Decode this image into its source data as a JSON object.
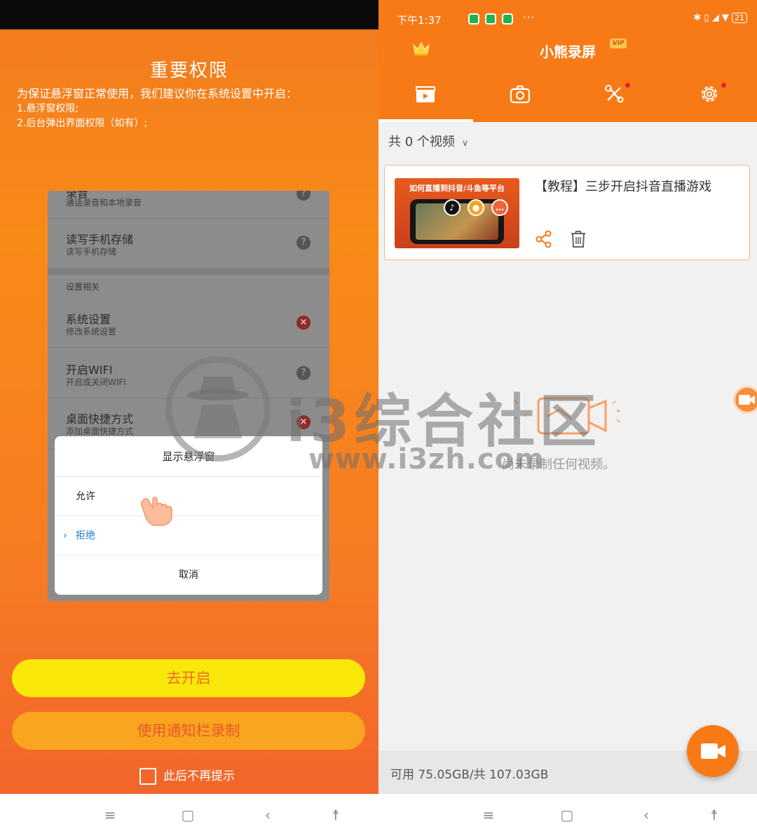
{
  "left": {
    "title": "重要权限",
    "description": "为保证悬浮窗正常使用，我们建议你在系统设置中开启：",
    "items": [
      "1.悬浮窗权限;",
      "2.后台弹出界面权限（如有）;"
    ],
    "permissions": [
      {
        "title": "录音",
        "subtitle": "通话录音和本地录音",
        "status": "help"
      },
      {
        "title": "读写手机存储",
        "subtitle": "读写手机存储",
        "status": "help"
      },
      {
        "title": "系统设置",
        "subtitle": "修改系统设置",
        "status": "deny"
      },
      {
        "title": "开启WIFI",
        "subtitle": "开启或关闭WIFI",
        "status": "help"
      },
      {
        "title": "桌面快捷方式",
        "subtitle": "添加桌面快捷方式",
        "status": "deny"
      }
    ],
    "section_label": "设置相关",
    "dialog": {
      "title": "显示悬浮窗",
      "options": [
        "允许",
        "拒绝"
      ],
      "selected": "拒绝",
      "cancel": "取消"
    },
    "primary_button": "去开启",
    "secondary_button": "使用通知栏录制",
    "checkbox_label": "此后不再提示"
  },
  "right": {
    "status_bar": {
      "time": "下午1:37",
      "more": "···",
      "battery": "21"
    },
    "app_title": "小熊录屏",
    "vip_badge": "VIP",
    "tabs": [
      {
        "icon": "video-tab-icon",
        "active": true
      },
      {
        "icon": "camera-tab-icon",
        "active": false
      },
      {
        "icon": "tools-tab-icon",
        "active": false,
        "dot": true
      },
      {
        "icon": "settings-tab-icon",
        "active": false,
        "dot": true
      }
    ],
    "filter_label": "共 0 个视频",
    "video": {
      "thumbnail_caption": "如何直播到抖音/斗鱼等平台",
      "title": "【教程】三步开启抖音直播游戏"
    },
    "empty_text": "尚未录制任何视频。",
    "storage": "可用 75.05GB/共 107.03GB"
  },
  "watermark": {
    "text": "i3综合社区",
    "url": "www.i3zh.com"
  },
  "colors": {
    "accent": "#f77a17",
    "yellow": "#fae80b",
    "select_blue": "#1a7fd6"
  }
}
